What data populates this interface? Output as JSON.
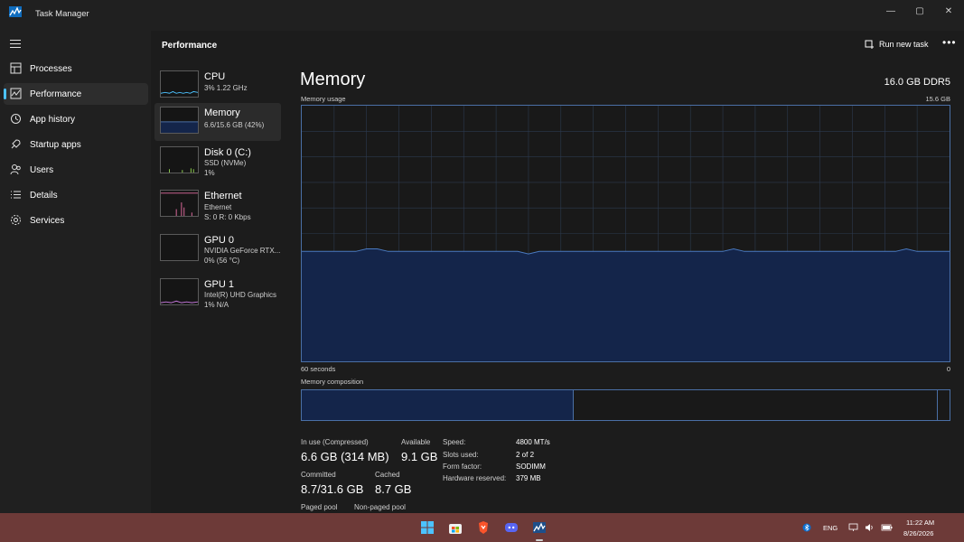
{
  "window": {
    "title": "Task Manager",
    "minimize": "—",
    "maximize": "▢",
    "close": "✕"
  },
  "sidebar": {
    "items": [
      {
        "label": "Processes",
        "icon": "processes-icon"
      },
      {
        "label": "Performance",
        "icon": "performance-icon",
        "active": true
      },
      {
        "label": "App history",
        "icon": "history-icon"
      },
      {
        "label": "Startup apps",
        "icon": "startup-icon"
      },
      {
        "label": "Users",
        "icon": "users-icon"
      },
      {
        "label": "Details",
        "icon": "details-icon"
      },
      {
        "label": "Services",
        "icon": "services-icon"
      }
    ]
  },
  "header": {
    "title": "Performance",
    "run_task": "Run new task",
    "more": "•••"
  },
  "devices": [
    {
      "name": "CPU",
      "line1": "3%  1.22 GHz",
      "line2": "",
      "color": "#4cc2ff"
    },
    {
      "name": "Memory",
      "line1": "6.6/15.6 GB (42%)",
      "line2": "",
      "color": "#4a6fa5"
    },
    {
      "name": "Disk 0 (C:)",
      "line1": "SSD (NVMe)",
      "line2": "1%",
      "color": "#8fd14f"
    },
    {
      "name": "Ethernet",
      "line1": "Ethernet",
      "line2": "S: 0 R: 0 Kbps",
      "color": "#e06c9f"
    },
    {
      "name": "GPU 0",
      "line1": "NVIDIA GeForce RTX...",
      "line2": "0%  (56 °C)",
      "color": "#8a8a8a"
    },
    {
      "name": "GPU 1",
      "line1": "Intel(R) UHD Graphics",
      "line2": "1%  N/A",
      "color": "#c678dd"
    }
  ],
  "memory": {
    "title": "Memory",
    "spec": "16.0 GB DDR5",
    "usage_label": "Memory usage",
    "usage_max": "15.6 GB",
    "time_left": "60 seconds",
    "time_right": "0",
    "composition_label": "Memory composition",
    "in_use_fraction": 0.42,
    "stats": {
      "in_use_label": "In use (Compressed)",
      "in_use_value": "6.6 GB (314 MB)",
      "available_label": "Available",
      "available_value": "9.1 GB",
      "committed_label": "Committed",
      "committed_value": "8.7/31.6 GB",
      "cached_label": "Cached",
      "cached_value": "8.7 GB",
      "paged_label": "Paged pool",
      "nonpaged_label": "Non-paged pool"
    },
    "specs": {
      "speed_label": "Speed:",
      "speed_value": "4800 MT/s",
      "slots_label": "Slots used:",
      "slots_value": "2 of 2",
      "form_label": "Form factor:",
      "form_value": "SODIMM",
      "reserved_label": "Hardware reserved:",
      "reserved_value": "379 MB"
    },
    "usage_history": [
      0.43,
      0.43,
      0.43,
      0.43,
      0.43,
      0.43,
      0.44,
      0.44,
      0.43,
      0.43,
      0.43,
      0.43,
      0.43,
      0.43,
      0.43,
      0.43,
      0.43,
      0.43,
      0.43,
      0.43,
      0.43,
      0.42,
      0.43,
      0.43,
      0.43,
      0.43,
      0.43,
      0.43,
      0.43,
      0.43,
      0.43,
      0.43,
      0.43,
      0.43,
      0.43,
      0.43,
      0.43,
      0.43,
      0.43,
      0.43,
      0.44,
      0.43,
      0.43,
      0.43,
      0.43,
      0.43,
      0.43,
      0.43,
      0.43,
      0.43,
      0.43,
      0.43,
      0.43,
      0.43,
      0.43,
      0.43,
      0.44,
      0.43,
      0.43,
      0.43,
      0.43
    ]
  },
  "taskbar": {
    "lang": "ENG",
    "time": "11:22 AM",
    "date": "8/26/2026"
  }
}
